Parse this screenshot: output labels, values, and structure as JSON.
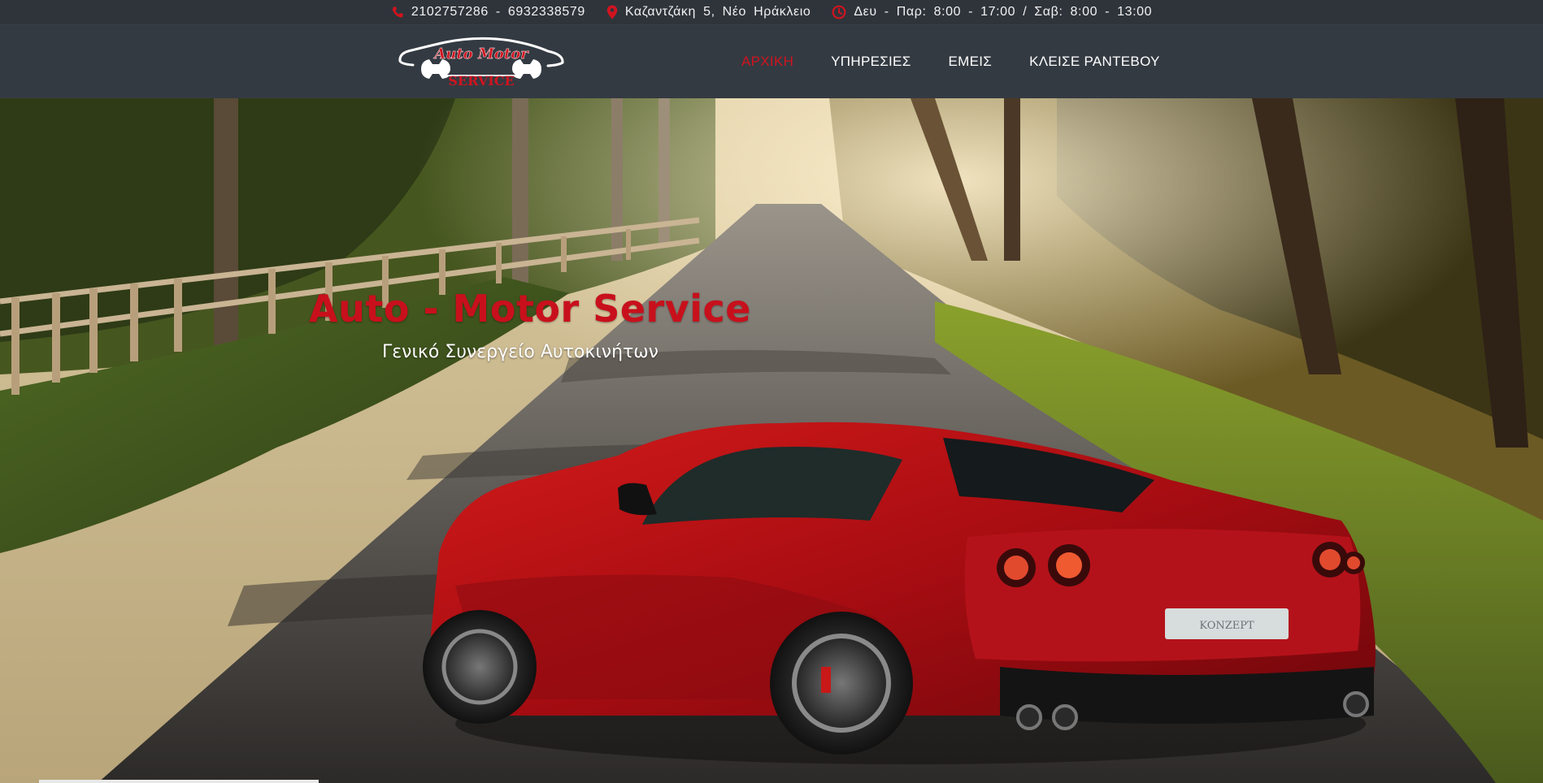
{
  "topbar": {
    "phone": "2102757286 - 6932338579",
    "address": "Καζαντζάκη 5, Νέο Ηράκλειο",
    "hours": "Δευ - Παρ: 8:00 - 17:00 / Σαβ: 8:00 - 13:00",
    "icons": [
      "phone-icon",
      "location-pin-icon",
      "clock-icon"
    ],
    "icon_color": "#d0141f"
  },
  "logo": {
    "line1": "Auto Motor",
    "line2": "SERVICE",
    "color": "#d0141f"
  },
  "nav": {
    "items": [
      {
        "label": "ΑΡΧΙΚΗ",
        "active": true
      },
      {
        "label": "ΥΠΗΡΕΣΙΕΣ",
        "active": false
      },
      {
        "label": "ΕΜΕΙΣ",
        "active": false
      },
      {
        "label": "ΚΛΕΙΣΕ ΡΑΝΤΕΒΟΥ",
        "active": false
      }
    ],
    "active_color": "#d0141f"
  },
  "hero": {
    "title": "Auto - Motor Service",
    "subtitle": "Γενικό Συνεργείο Αυτοκινήτων",
    "title_color": "#c8101c",
    "image": "red sports car on a tree-lined country road",
    "plate_text": "KONZEPT"
  }
}
